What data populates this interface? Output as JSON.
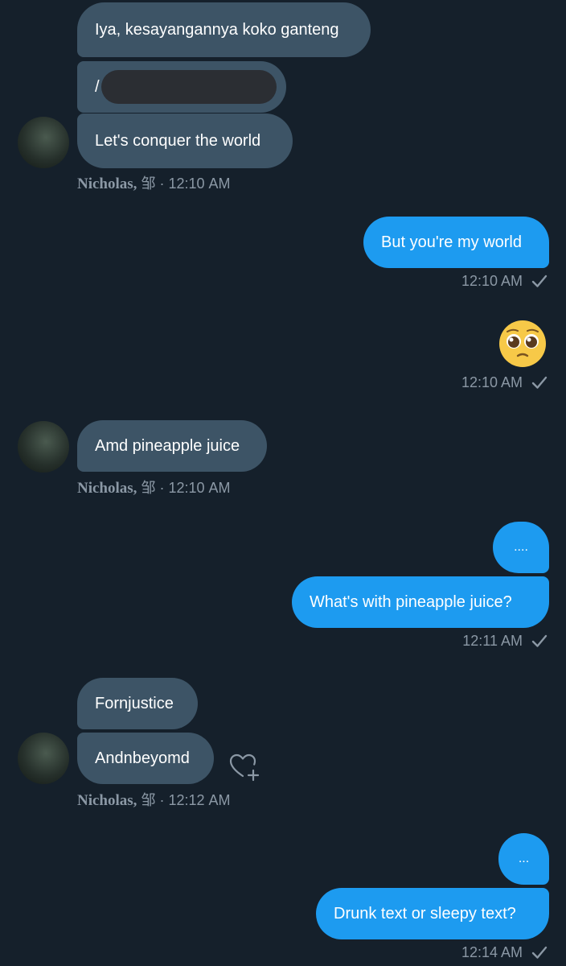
{
  "contact": {
    "name": "Nicholas,",
    "initial": "邹"
  },
  "messages": {
    "m1": "Iya, kesayangannya koko ganteng",
    "m2": "/",
    "m3": "Let's conquer the world",
    "meta1": "· 12:10 AM",
    "m4": "But you're my world",
    "t4": "12:10 AM",
    "m5": "🥺",
    "t5": "12:10 AM",
    "m6": "Amd pineapple juice",
    "meta2": "· 12:10 AM",
    "m7": "....",
    "m8": "What's with pineapple juice?",
    "t8": "12:11 AM",
    "m9": "Fornjustice",
    "m10": "Andnbeyomd",
    "meta3": "· 12:12 AM",
    "m11": "...",
    "m12": "Drunk text or sleepy text?",
    "t12": "12:14 AM"
  },
  "colors": {
    "background": "#15202b",
    "incoming": "#3d5466",
    "outgoing": "#1d9bf0",
    "muted": "#8b98a5"
  },
  "icons": [
    "avatar",
    "checkmark-icon",
    "add-reaction-heart-icon"
  ]
}
